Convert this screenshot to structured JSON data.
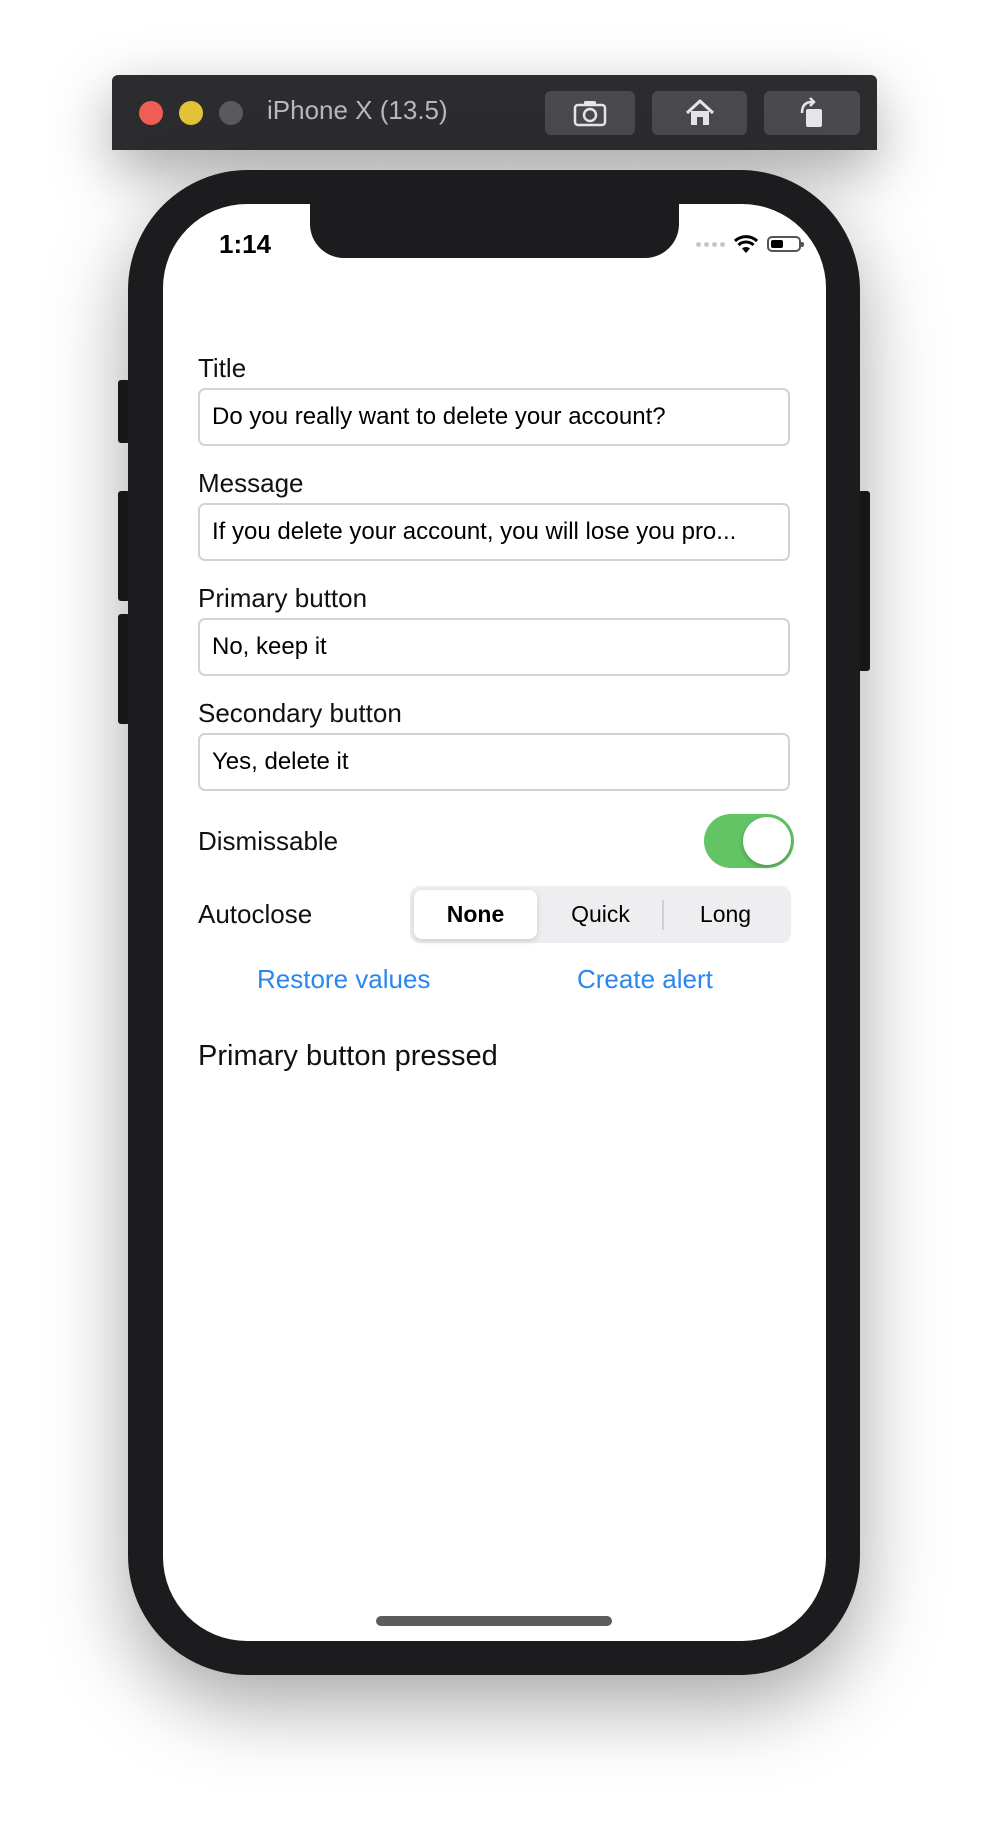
{
  "simulator": {
    "title": "iPhone X (13.5)",
    "toolbar": [
      "screenshot-icon",
      "home-icon",
      "rotate-icon"
    ]
  },
  "status_bar": {
    "time": "1:14",
    "icons": [
      "cellular-icon",
      "wifi-icon",
      "battery-icon"
    ]
  },
  "form": {
    "title_label": "Title",
    "title_value": "Do you really want to delete your account?",
    "message_label": "Message",
    "message_value": "If you delete your account, you will lose you pro...",
    "primary_label": "Primary button",
    "primary_value": "No, keep it",
    "secondary_label": "Secondary button",
    "secondary_value": "Yes, delete it",
    "dismissable_label": "Dismissable",
    "dismissable_on": true,
    "autoclose_label": "Autoclose",
    "autoclose_options": [
      "None",
      "Quick",
      "Long"
    ],
    "autoclose_selected": "None"
  },
  "actions": {
    "restore_label": "Restore values",
    "create_label": "Create alert"
  },
  "result": {
    "text": "Primary button pressed"
  },
  "colors": {
    "accent": "#2a86f0",
    "toggle_on": "#63c466",
    "close": "#ee5e55",
    "minimize": "#e4c237"
  }
}
